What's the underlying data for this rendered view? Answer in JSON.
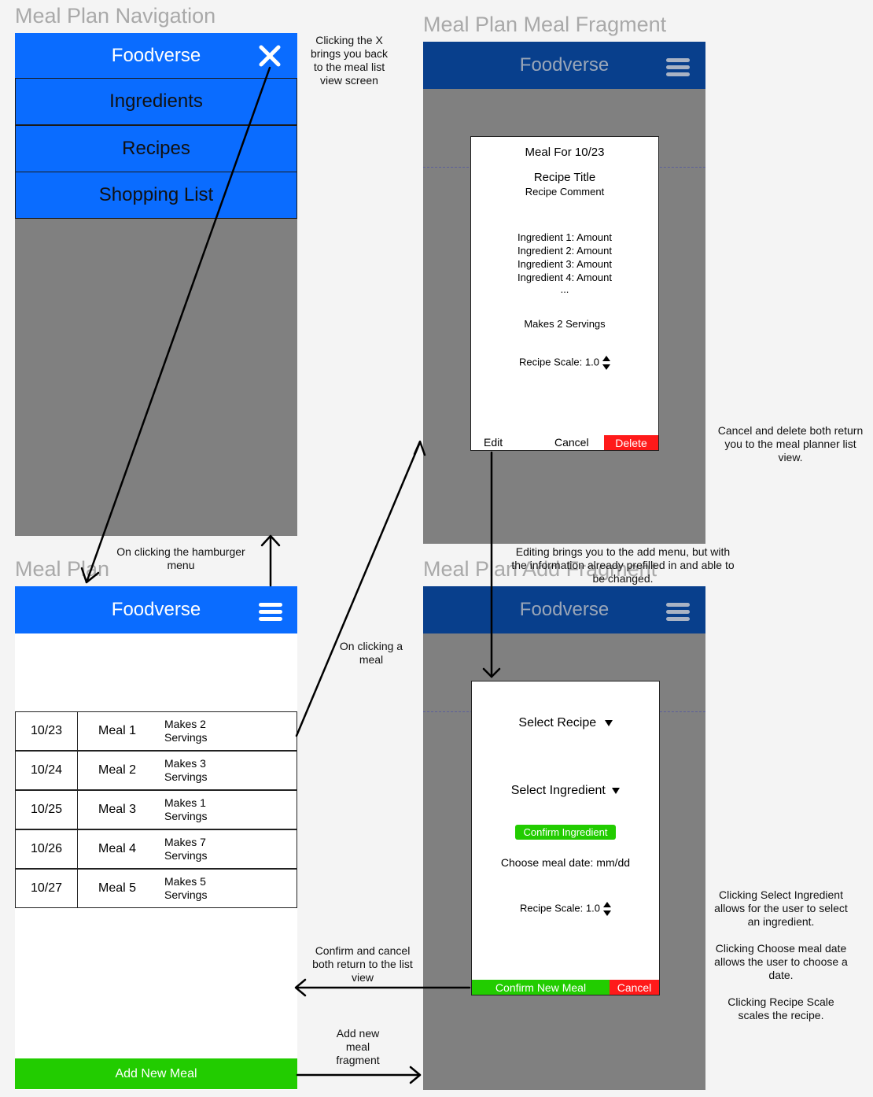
{
  "frames": {
    "navigation": {
      "title": "Meal Plan Navigation",
      "app_name": "Foodverse",
      "menu_items": [
        "Ingredients",
        "Recipes",
        "Shopping List"
      ]
    },
    "meal_plan": {
      "title": "Meal Plan",
      "app_name": "Foodverse",
      "rows": [
        {
          "date": "10/23",
          "meal": "Meal 1",
          "servings_line1": "Makes 2",
          "servings_line2": "Servings"
        },
        {
          "date": "10/24",
          "meal": "Meal 2",
          "servings_line1": "Makes 3",
          "servings_line2": "Servings"
        },
        {
          "date": "10/25",
          "meal": "Meal 3",
          "servings_line1": "Makes 1",
          "servings_line2": "Servings"
        },
        {
          "date": "10/26",
          "meal": "Meal 4",
          "servings_line1": "Makes 7",
          "servings_line2": "Servings"
        },
        {
          "date": "10/27",
          "meal": "Meal 5",
          "servings_line1": "Makes 5",
          "servings_line2": "Servings"
        }
      ],
      "add_button": "Add New Meal"
    },
    "meal_fragment": {
      "title": "Meal Plan Meal Fragment",
      "app_name": "Foodverse",
      "dialog": {
        "heading": "Meal For 10/23",
        "recipe_title": "Recipe Title",
        "recipe_comment": "Recipe Comment",
        "ingredients": [
          "Ingredient 1: Amount",
          "Ingredient 2: Amount",
          "Ingredient 3: Amount",
          "Ingredient 4: Amount",
          "..."
        ],
        "servings": "Makes 2 Servings",
        "scale": "Recipe Scale: 1.0",
        "edit": "Edit",
        "cancel": "Cancel",
        "delete": "Delete"
      }
    },
    "add_fragment": {
      "title": "Meal Plan Add Fragment",
      "app_name": "Foodverse",
      "dialog": {
        "select_recipe": "Select Recipe",
        "select_ingredient": "Select Ingredient",
        "confirm_ingredient": "Confirm Ingredient",
        "choose_date": "Choose meal date: mm/dd",
        "scale": "Recipe Scale: 1.0",
        "confirm": "Confirm New Meal",
        "cancel": "Cancel"
      }
    }
  },
  "notes": {
    "x_back": [
      "Clicking the X",
      "brings you back",
      "to the meal list",
      "view screen"
    ],
    "hamburger": [
      "On clicking the hamburger",
      "menu"
    ],
    "click_meal": [
      "On clicking a",
      "meal"
    ],
    "cancel_delete": [
      "Cancel and delete both return",
      "you to the meal planner list",
      "view."
    ],
    "editing": [
      "Editing brings you to the add menu, but with",
      "the information already prefilled in and able to",
      "be changed."
    ],
    "confirm_cancel": [
      "Confirm and cancel",
      "both return to the list",
      "view"
    ],
    "add_new": [
      "Add new",
      "meal",
      "fragment"
    ],
    "select_ingredient_note": [
      "Clicking Select Ingredient",
      "allows for the user to select",
      "an ingredient."
    ],
    "choose_date_note": [
      "Clicking Choose meal date",
      "allows the user to choose a",
      "date."
    ],
    "scale_note": [
      "Clicking Recipe Scale",
      "scales the recipe."
    ]
  },
  "icons": {
    "close": "close-icon",
    "menu": "hamburger-menu-icon",
    "spinner": "up-down-spinner-icon",
    "dropdown": "dropdown-triangle-icon"
  },
  "colors": {
    "primary_blue": "#0a6cff",
    "dark_blue": "#083f8c",
    "grey": "#808080",
    "green": "#22cc00",
    "red": "#ff1a1a"
  }
}
